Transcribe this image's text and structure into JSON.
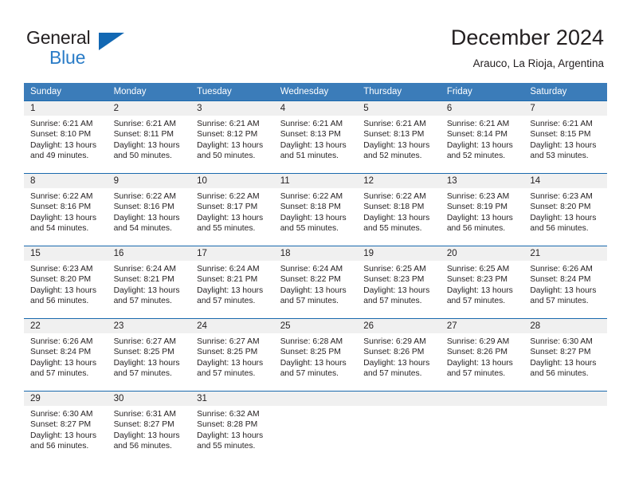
{
  "brand": {
    "name_line1": "General",
    "name_line2": "Blue",
    "accent_color": "#1268b3",
    "blue_text_color": "#2a7cc7"
  },
  "header": {
    "title": "December 2024",
    "location": "Arauco, La Rioja, Argentina"
  },
  "theme": {
    "header_row_bg": "#3b7cb9",
    "day_band_bg": "#f0f0f0",
    "week_separator": "#1a6aad",
    "text": "#231f20"
  },
  "weekday_headers": [
    "Sunday",
    "Monday",
    "Tuesday",
    "Wednesday",
    "Thursday",
    "Friday",
    "Saturday"
  ],
  "weeks": [
    {
      "days": [
        {
          "date": "1",
          "sunrise": "Sunrise: 6:21 AM",
          "sunset": "Sunset: 8:10 PM",
          "daylight": "Daylight: 13 hours and 49 minutes."
        },
        {
          "date": "2",
          "sunrise": "Sunrise: 6:21 AM",
          "sunset": "Sunset: 8:11 PM",
          "daylight": "Daylight: 13 hours and 50 minutes."
        },
        {
          "date": "3",
          "sunrise": "Sunrise: 6:21 AM",
          "sunset": "Sunset: 8:12 PM",
          "daylight": "Daylight: 13 hours and 50 minutes."
        },
        {
          "date": "4",
          "sunrise": "Sunrise: 6:21 AM",
          "sunset": "Sunset: 8:13 PM",
          "daylight": "Daylight: 13 hours and 51 minutes."
        },
        {
          "date": "5",
          "sunrise": "Sunrise: 6:21 AM",
          "sunset": "Sunset: 8:13 PM",
          "daylight": "Daylight: 13 hours and 52 minutes."
        },
        {
          "date": "6",
          "sunrise": "Sunrise: 6:21 AM",
          "sunset": "Sunset: 8:14 PM",
          "daylight": "Daylight: 13 hours and 52 minutes."
        },
        {
          "date": "7",
          "sunrise": "Sunrise: 6:21 AM",
          "sunset": "Sunset: 8:15 PM",
          "daylight": "Daylight: 13 hours and 53 minutes."
        }
      ]
    },
    {
      "days": [
        {
          "date": "8",
          "sunrise": "Sunrise: 6:22 AM",
          "sunset": "Sunset: 8:16 PM",
          "daylight": "Daylight: 13 hours and 54 minutes."
        },
        {
          "date": "9",
          "sunrise": "Sunrise: 6:22 AM",
          "sunset": "Sunset: 8:16 PM",
          "daylight": "Daylight: 13 hours and 54 minutes."
        },
        {
          "date": "10",
          "sunrise": "Sunrise: 6:22 AM",
          "sunset": "Sunset: 8:17 PM",
          "daylight": "Daylight: 13 hours and 55 minutes."
        },
        {
          "date": "11",
          "sunrise": "Sunrise: 6:22 AM",
          "sunset": "Sunset: 8:18 PM",
          "daylight": "Daylight: 13 hours and 55 minutes."
        },
        {
          "date": "12",
          "sunrise": "Sunrise: 6:22 AM",
          "sunset": "Sunset: 8:18 PM",
          "daylight": "Daylight: 13 hours and 55 minutes."
        },
        {
          "date": "13",
          "sunrise": "Sunrise: 6:23 AM",
          "sunset": "Sunset: 8:19 PM",
          "daylight": "Daylight: 13 hours and 56 minutes."
        },
        {
          "date": "14",
          "sunrise": "Sunrise: 6:23 AM",
          "sunset": "Sunset: 8:20 PM",
          "daylight": "Daylight: 13 hours and 56 minutes."
        }
      ]
    },
    {
      "days": [
        {
          "date": "15",
          "sunrise": "Sunrise: 6:23 AM",
          "sunset": "Sunset: 8:20 PM",
          "daylight": "Daylight: 13 hours and 56 minutes."
        },
        {
          "date": "16",
          "sunrise": "Sunrise: 6:24 AM",
          "sunset": "Sunset: 8:21 PM",
          "daylight": "Daylight: 13 hours and 57 minutes."
        },
        {
          "date": "17",
          "sunrise": "Sunrise: 6:24 AM",
          "sunset": "Sunset: 8:21 PM",
          "daylight": "Daylight: 13 hours and 57 minutes."
        },
        {
          "date": "18",
          "sunrise": "Sunrise: 6:24 AM",
          "sunset": "Sunset: 8:22 PM",
          "daylight": "Daylight: 13 hours and 57 minutes."
        },
        {
          "date": "19",
          "sunrise": "Sunrise: 6:25 AM",
          "sunset": "Sunset: 8:23 PM",
          "daylight": "Daylight: 13 hours and 57 minutes."
        },
        {
          "date": "20",
          "sunrise": "Sunrise: 6:25 AM",
          "sunset": "Sunset: 8:23 PM",
          "daylight": "Daylight: 13 hours and 57 minutes."
        },
        {
          "date": "21",
          "sunrise": "Sunrise: 6:26 AM",
          "sunset": "Sunset: 8:24 PM",
          "daylight": "Daylight: 13 hours and 57 minutes."
        }
      ]
    },
    {
      "days": [
        {
          "date": "22",
          "sunrise": "Sunrise: 6:26 AM",
          "sunset": "Sunset: 8:24 PM",
          "daylight": "Daylight: 13 hours and 57 minutes."
        },
        {
          "date": "23",
          "sunrise": "Sunrise: 6:27 AM",
          "sunset": "Sunset: 8:25 PM",
          "daylight": "Daylight: 13 hours and 57 minutes."
        },
        {
          "date": "24",
          "sunrise": "Sunrise: 6:27 AM",
          "sunset": "Sunset: 8:25 PM",
          "daylight": "Daylight: 13 hours and 57 minutes."
        },
        {
          "date": "25",
          "sunrise": "Sunrise: 6:28 AM",
          "sunset": "Sunset: 8:25 PM",
          "daylight": "Daylight: 13 hours and 57 minutes."
        },
        {
          "date": "26",
          "sunrise": "Sunrise: 6:29 AM",
          "sunset": "Sunset: 8:26 PM",
          "daylight": "Daylight: 13 hours and 57 minutes."
        },
        {
          "date": "27",
          "sunrise": "Sunrise: 6:29 AM",
          "sunset": "Sunset: 8:26 PM",
          "daylight": "Daylight: 13 hours and 57 minutes."
        },
        {
          "date": "28",
          "sunrise": "Sunrise: 6:30 AM",
          "sunset": "Sunset: 8:27 PM",
          "daylight": "Daylight: 13 hours and 56 minutes."
        }
      ]
    },
    {
      "days": [
        {
          "date": "29",
          "sunrise": "Sunrise: 6:30 AM",
          "sunset": "Sunset: 8:27 PM",
          "daylight": "Daylight: 13 hours and 56 minutes."
        },
        {
          "date": "30",
          "sunrise": "Sunrise: 6:31 AM",
          "sunset": "Sunset: 8:27 PM",
          "daylight": "Daylight: 13 hours and 56 minutes."
        },
        {
          "date": "31",
          "sunrise": "Sunrise: 6:32 AM",
          "sunset": "Sunset: 8:28 PM",
          "daylight": "Daylight: 13 hours and 55 minutes."
        },
        {
          "date": "",
          "sunrise": "",
          "sunset": "",
          "daylight": ""
        },
        {
          "date": "",
          "sunrise": "",
          "sunset": "",
          "daylight": ""
        },
        {
          "date": "",
          "sunrise": "",
          "sunset": "",
          "daylight": ""
        },
        {
          "date": "",
          "sunrise": "",
          "sunset": "",
          "daylight": ""
        }
      ]
    }
  ]
}
